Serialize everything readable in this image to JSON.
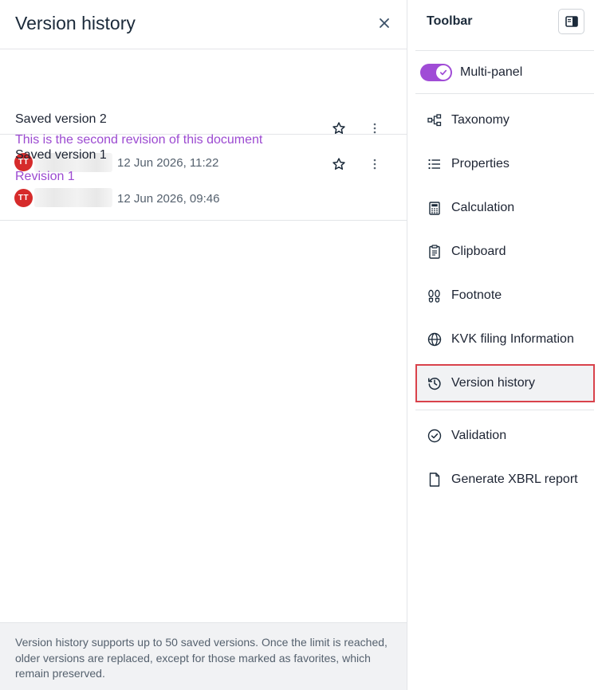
{
  "left_panel": {
    "title": "Version history",
    "versions": [
      {
        "title": "Saved version 2",
        "description": "This is the second revision of this document",
        "avatar_initials": "TT",
        "date": "12 Jun 2026, 11:22"
      },
      {
        "title": "Saved version 1",
        "description": "Revision 1",
        "avatar_initials": "TT",
        "date": "12 Jun 2026, 09:46"
      }
    ],
    "footer_text": "Version history supports up to 50 saved versions. Once the limit is reached, older versions are replaced, except for those marked as favorites, which remain preserved."
  },
  "toolbar": {
    "title": "Toolbar",
    "multi_panel_label": "Multi-panel",
    "multi_panel_enabled": true,
    "items": [
      {
        "label": "Taxonomy",
        "icon": "taxonomy-icon"
      },
      {
        "label": "Properties",
        "icon": "list-icon"
      },
      {
        "label": "Calculation",
        "icon": "calculator-icon"
      },
      {
        "label": "Clipboard",
        "icon": "clipboard-icon"
      },
      {
        "label": "Footnote",
        "icon": "footprints-icon"
      },
      {
        "label": "KVK filing Information",
        "icon": "globe-icon"
      },
      {
        "label": "Version history",
        "icon": "history-icon",
        "active": true
      },
      {
        "label": "Validation",
        "icon": "check-circle-icon"
      },
      {
        "label": "Generate XBRL report",
        "icon": "document-icon"
      }
    ]
  },
  "colors": {
    "accent": "#a04cd6",
    "description_text": "#9c4ad1",
    "avatar": "#d62b2b",
    "active_outline": "#d9424b"
  }
}
